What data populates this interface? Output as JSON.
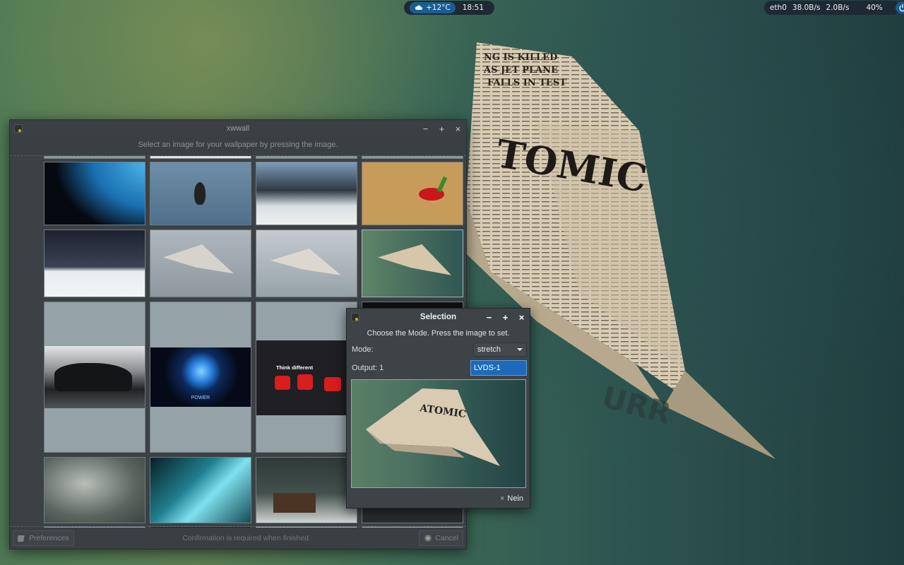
{
  "panel": {
    "weather": "+12°C",
    "time": "18:51",
    "net_iface": "eth0",
    "net_down": "38.0B/s",
    "net_up": "2.0B/s",
    "volume": "40%"
  },
  "main_window": {
    "title": "xwwall",
    "instruction": "Select an image for your wallpaper by pressing the image.",
    "footer_text": "Confirmation is required when finished.",
    "preferences_label": "Preferences",
    "cancel_label": "Cancel",
    "thumb_labels": {
      "power": "POWER",
      "think_different": "Think different"
    }
  },
  "selection_dialog": {
    "title": "Selection",
    "instruction": "Choose the Mode. Press the image to set.",
    "mode_label": "Mode:",
    "mode_value": "stretch",
    "output_label": "Output: 1",
    "output_value": "LVDS-1",
    "nein_label": "Nein"
  },
  "window_controls": {
    "minimize": "−",
    "maximize": "+",
    "close": "×"
  },
  "colors": {
    "accent": "#1d6ab8",
    "panel_bg": "#1e2a33",
    "window_bg": "#3a3f44"
  },
  "icons": [
    "cloud-icon",
    "eye-icon",
    "network-icon",
    "speaker-icon",
    "power-icon",
    "app-icon",
    "chevron-down-icon",
    "close-icon"
  ]
}
